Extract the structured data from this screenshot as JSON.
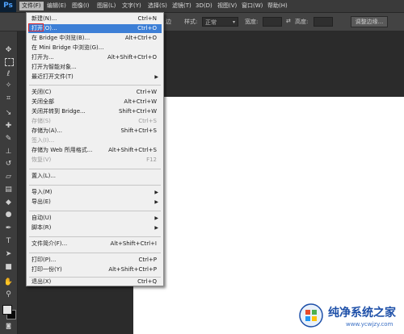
{
  "app": {
    "logo": "Ps"
  },
  "menubar": {
    "items": [
      "文件(F)",
      "编辑(E)",
      "图像(I)",
      "图层(L)",
      "文字(Y)",
      "选择(S)",
      "滤镜(T)",
      "3D(D)",
      "视图(V)",
      "窗口(W)",
      "帮助(H)"
    ]
  },
  "options": {
    "partial_label": "边",
    "style_label": "样式:",
    "style_value": "正常",
    "width_label": "宽度:",
    "height_label": "高度:",
    "refine_button": "调整边缘..."
  },
  "file_menu": {
    "items": [
      {
        "label": "新建(N)...",
        "shortcut": "Ctrl+N"
      },
      {
        "label": "打开(O)...",
        "shortcut": "Ctrl+O",
        "highlighted": true
      },
      {
        "label": "在 Bridge 中浏览(B)...",
        "shortcut": "Alt+Ctrl+O"
      },
      {
        "label": "在 Mini Bridge 中浏览(G)...",
        "shortcut": ""
      },
      {
        "label": "打开为...",
        "shortcut": "Alt+Shift+Ctrl+O"
      },
      {
        "label": "打开为智能对象...",
        "shortcut": ""
      },
      {
        "label": "最近打开文件(T)",
        "shortcut": "",
        "submenu": true
      },
      {
        "label": "关闭(C)",
        "shortcut": "Ctrl+W"
      },
      {
        "label": "关闭全部",
        "shortcut": "Alt+Ctrl+W"
      },
      {
        "label": "关闭并转到 Bridge...",
        "shortcut": "Shift+Ctrl+W"
      },
      {
        "label": "存储(S)",
        "shortcut": "Ctrl+S",
        "disabled": true
      },
      {
        "label": "存储为(A)...",
        "shortcut": "Shift+Ctrl+S"
      },
      {
        "label": "签入(I)...",
        "shortcut": "",
        "disabled": true
      },
      {
        "label": "存储为 Web 所用格式...",
        "shortcut": "Alt+Shift+Ctrl+S"
      },
      {
        "label": "恢复(V)",
        "shortcut": "F12",
        "disabled": true
      },
      {
        "label": "置入(L)...",
        "shortcut": ""
      },
      {
        "label": "导入(M)",
        "shortcut": "",
        "submenu": true
      },
      {
        "label": "导出(E)",
        "shortcut": "",
        "submenu": true
      },
      {
        "label": "自动(U)",
        "shortcut": "",
        "submenu": true
      },
      {
        "label": "脚本(R)",
        "shortcut": "",
        "submenu": true
      },
      {
        "label": "文件简介(F)...",
        "shortcut": "Alt+Shift+Ctrl+I"
      },
      {
        "label": "打印(P)...",
        "shortcut": "Ctrl+P"
      },
      {
        "label": "打印一份(Y)",
        "shortcut": "Alt+Shift+Ctrl+P"
      },
      {
        "label": "退出(X)",
        "shortcut": "Ctrl+Q"
      }
    ]
  },
  "watermark": {
    "title": "纯净系统之家",
    "url": "www.ycwjzy.com"
  },
  "colors": {
    "highlight": "#3d7fd6",
    "focus_ring": "#e0262a",
    "brand": "#1d4fa8"
  },
  "tools": [
    "move-icon",
    "marquee-icon",
    "lasso-icon",
    "magic-wand-icon",
    "crop-icon",
    "eyedropper-icon",
    "healing-icon",
    "brush-icon",
    "stamp-icon",
    "history-brush-icon",
    "eraser-icon",
    "gradient-icon",
    "blur-icon",
    "dodge-icon",
    "pen-icon",
    "type-icon",
    "path-select-icon",
    "shape-icon",
    "hand-icon",
    "zoom-icon"
  ]
}
